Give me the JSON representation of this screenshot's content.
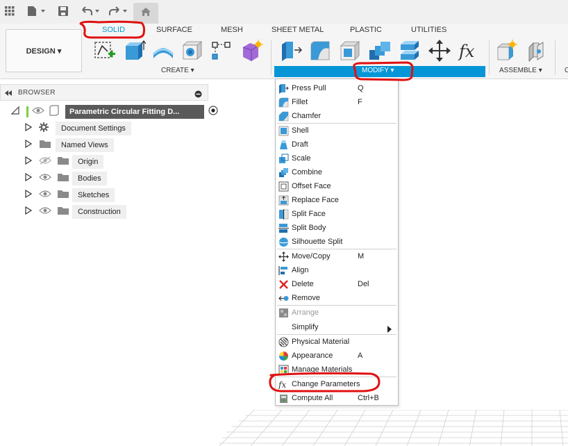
{
  "app": {
    "icons": [
      "grid-icon",
      "file-icon",
      "save-icon",
      "undo-icon",
      "redo-icon",
      "home-icon"
    ]
  },
  "toolbar": {
    "workspace_label": "DESIGN ▾",
    "tabs": [
      "SOLID",
      "SURFACE",
      "MESH",
      "SHEET METAL",
      "PLASTIC",
      "UTILITIES"
    ],
    "active_tab": "SOLID",
    "groups": {
      "create": "CREATE ▾",
      "modify": "MODIFY ▾",
      "assemble": "ASSEMBLE ▾",
      "construct_partial": "C"
    },
    "accent_color": "#0696d7"
  },
  "browser": {
    "title": "BROWSER",
    "root": "Parametric Circular Fitting D...",
    "items": [
      {
        "label": "Document Settings",
        "icon": "gear-icon"
      },
      {
        "label": "Named Views",
        "icon": "folder-icon"
      },
      {
        "label": "Origin",
        "icon": "folder-icon",
        "visibility": "hidden"
      },
      {
        "label": "Bodies",
        "icon": "folder-icon",
        "visibility": "visible"
      },
      {
        "label": "Sketches",
        "icon": "folder-icon",
        "visibility": "visible"
      },
      {
        "label": "Construction",
        "icon": "folder-icon",
        "visibility": "visible"
      }
    ]
  },
  "modify_menu": {
    "items": [
      {
        "label": "Press Pull",
        "shortcut": "Q",
        "icon": "press-pull-icon"
      },
      {
        "label": "Fillet",
        "shortcut": "F",
        "icon": "fillet-icon"
      },
      {
        "label": "Chamfer",
        "shortcut": "",
        "icon": "chamfer-icon"
      },
      {
        "label": "Shell",
        "shortcut": "",
        "icon": "shell-icon"
      },
      {
        "label": "Draft",
        "shortcut": "",
        "icon": "draft-icon"
      },
      {
        "label": "Scale",
        "shortcut": "",
        "icon": "scale-icon"
      },
      {
        "label": "Combine",
        "shortcut": "",
        "icon": "combine-icon"
      },
      {
        "label": "Offset Face",
        "shortcut": "",
        "icon": "offset-face-icon"
      },
      {
        "label": "Replace Face",
        "shortcut": "",
        "icon": "replace-face-icon"
      },
      {
        "label": "Split Face",
        "shortcut": "",
        "icon": "split-face-icon"
      },
      {
        "label": "Split Body",
        "shortcut": "",
        "icon": "split-body-icon"
      },
      {
        "label": "Silhouette Split",
        "shortcut": "",
        "icon": "silhouette-split-icon"
      },
      {
        "label": "Move/Copy",
        "shortcut": "M",
        "icon": "move-icon"
      },
      {
        "label": "Align",
        "shortcut": "",
        "icon": "align-icon"
      },
      {
        "label": "Delete",
        "shortcut": "Del",
        "icon": "delete-icon"
      },
      {
        "label": "Remove",
        "shortcut": "",
        "icon": "remove-icon"
      },
      {
        "label": "Arrange",
        "shortcut": "",
        "icon": "arrange-icon",
        "disabled": true
      },
      {
        "label": "Simplify",
        "shortcut": "",
        "icon": "",
        "submenu": true
      },
      {
        "label": "Physical Material",
        "shortcut": "",
        "icon": "physical-material-icon"
      },
      {
        "label": "Appearance",
        "shortcut": "A",
        "icon": "appearance-icon"
      },
      {
        "label": "Manage Materials",
        "shortcut": "",
        "icon": "manage-materials-icon"
      },
      {
        "label": "Change Parameters",
        "shortcut": "",
        "icon": "fx-icon"
      },
      {
        "label": "Compute All",
        "shortcut": "Ctrl+B",
        "icon": "compute-all-icon"
      }
    ]
  }
}
